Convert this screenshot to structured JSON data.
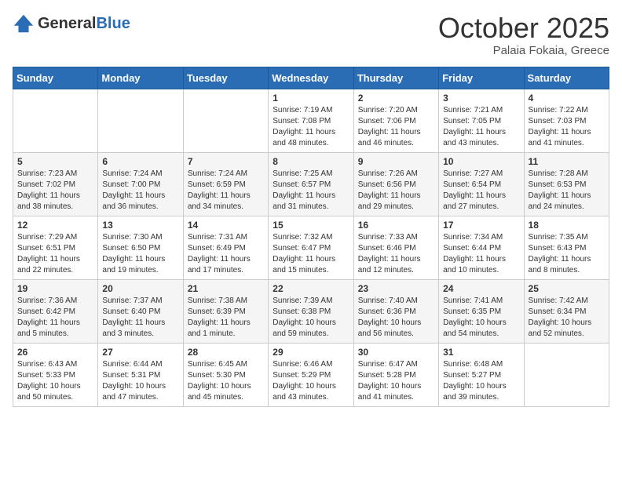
{
  "logo": {
    "general": "General",
    "blue": "Blue"
  },
  "title": {
    "month_year": "October 2025",
    "location": "Palaia Fokaia, Greece"
  },
  "headers": [
    "Sunday",
    "Monday",
    "Tuesday",
    "Wednesday",
    "Thursday",
    "Friday",
    "Saturday"
  ],
  "weeks": [
    [
      {
        "day": "",
        "info": ""
      },
      {
        "day": "",
        "info": ""
      },
      {
        "day": "",
        "info": ""
      },
      {
        "day": "1",
        "info": "Sunrise: 7:19 AM\nSunset: 7:08 PM\nDaylight: 11 hours and 48 minutes."
      },
      {
        "day": "2",
        "info": "Sunrise: 7:20 AM\nSunset: 7:06 PM\nDaylight: 11 hours and 46 minutes."
      },
      {
        "day": "3",
        "info": "Sunrise: 7:21 AM\nSunset: 7:05 PM\nDaylight: 11 hours and 43 minutes."
      },
      {
        "day": "4",
        "info": "Sunrise: 7:22 AM\nSunset: 7:03 PM\nDaylight: 11 hours and 41 minutes."
      }
    ],
    [
      {
        "day": "5",
        "info": "Sunrise: 7:23 AM\nSunset: 7:02 PM\nDaylight: 11 hours and 38 minutes."
      },
      {
        "day": "6",
        "info": "Sunrise: 7:24 AM\nSunset: 7:00 PM\nDaylight: 11 hours and 36 minutes."
      },
      {
        "day": "7",
        "info": "Sunrise: 7:24 AM\nSunset: 6:59 PM\nDaylight: 11 hours and 34 minutes."
      },
      {
        "day": "8",
        "info": "Sunrise: 7:25 AM\nSunset: 6:57 PM\nDaylight: 11 hours and 31 minutes."
      },
      {
        "day": "9",
        "info": "Sunrise: 7:26 AM\nSunset: 6:56 PM\nDaylight: 11 hours and 29 minutes."
      },
      {
        "day": "10",
        "info": "Sunrise: 7:27 AM\nSunset: 6:54 PM\nDaylight: 11 hours and 27 minutes."
      },
      {
        "day": "11",
        "info": "Sunrise: 7:28 AM\nSunset: 6:53 PM\nDaylight: 11 hours and 24 minutes."
      }
    ],
    [
      {
        "day": "12",
        "info": "Sunrise: 7:29 AM\nSunset: 6:51 PM\nDaylight: 11 hours and 22 minutes."
      },
      {
        "day": "13",
        "info": "Sunrise: 7:30 AM\nSunset: 6:50 PM\nDaylight: 11 hours and 19 minutes."
      },
      {
        "day": "14",
        "info": "Sunrise: 7:31 AM\nSunset: 6:49 PM\nDaylight: 11 hours and 17 minutes."
      },
      {
        "day": "15",
        "info": "Sunrise: 7:32 AM\nSunset: 6:47 PM\nDaylight: 11 hours and 15 minutes."
      },
      {
        "day": "16",
        "info": "Sunrise: 7:33 AM\nSunset: 6:46 PM\nDaylight: 11 hours and 12 minutes."
      },
      {
        "day": "17",
        "info": "Sunrise: 7:34 AM\nSunset: 6:44 PM\nDaylight: 11 hours and 10 minutes."
      },
      {
        "day": "18",
        "info": "Sunrise: 7:35 AM\nSunset: 6:43 PM\nDaylight: 11 hours and 8 minutes."
      }
    ],
    [
      {
        "day": "19",
        "info": "Sunrise: 7:36 AM\nSunset: 6:42 PM\nDaylight: 11 hours and 5 minutes."
      },
      {
        "day": "20",
        "info": "Sunrise: 7:37 AM\nSunset: 6:40 PM\nDaylight: 11 hours and 3 minutes."
      },
      {
        "day": "21",
        "info": "Sunrise: 7:38 AM\nSunset: 6:39 PM\nDaylight: 11 hours and 1 minute."
      },
      {
        "day": "22",
        "info": "Sunrise: 7:39 AM\nSunset: 6:38 PM\nDaylight: 10 hours and 59 minutes."
      },
      {
        "day": "23",
        "info": "Sunrise: 7:40 AM\nSunset: 6:36 PM\nDaylight: 10 hours and 56 minutes."
      },
      {
        "day": "24",
        "info": "Sunrise: 7:41 AM\nSunset: 6:35 PM\nDaylight: 10 hours and 54 minutes."
      },
      {
        "day": "25",
        "info": "Sunrise: 7:42 AM\nSunset: 6:34 PM\nDaylight: 10 hours and 52 minutes."
      }
    ],
    [
      {
        "day": "26",
        "info": "Sunrise: 6:43 AM\nSunset: 5:33 PM\nDaylight: 10 hours and 50 minutes."
      },
      {
        "day": "27",
        "info": "Sunrise: 6:44 AM\nSunset: 5:31 PM\nDaylight: 10 hours and 47 minutes."
      },
      {
        "day": "28",
        "info": "Sunrise: 6:45 AM\nSunset: 5:30 PM\nDaylight: 10 hours and 45 minutes."
      },
      {
        "day": "29",
        "info": "Sunrise: 6:46 AM\nSunset: 5:29 PM\nDaylight: 10 hours and 43 minutes."
      },
      {
        "day": "30",
        "info": "Sunrise: 6:47 AM\nSunset: 5:28 PM\nDaylight: 10 hours and 41 minutes."
      },
      {
        "day": "31",
        "info": "Sunrise: 6:48 AM\nSunset: 5:27 PM\nDaylight: 10 hours and 39 minutes."
      },
      {
        "day": "",
        "info": ""
      }
    ]
  ]
}
